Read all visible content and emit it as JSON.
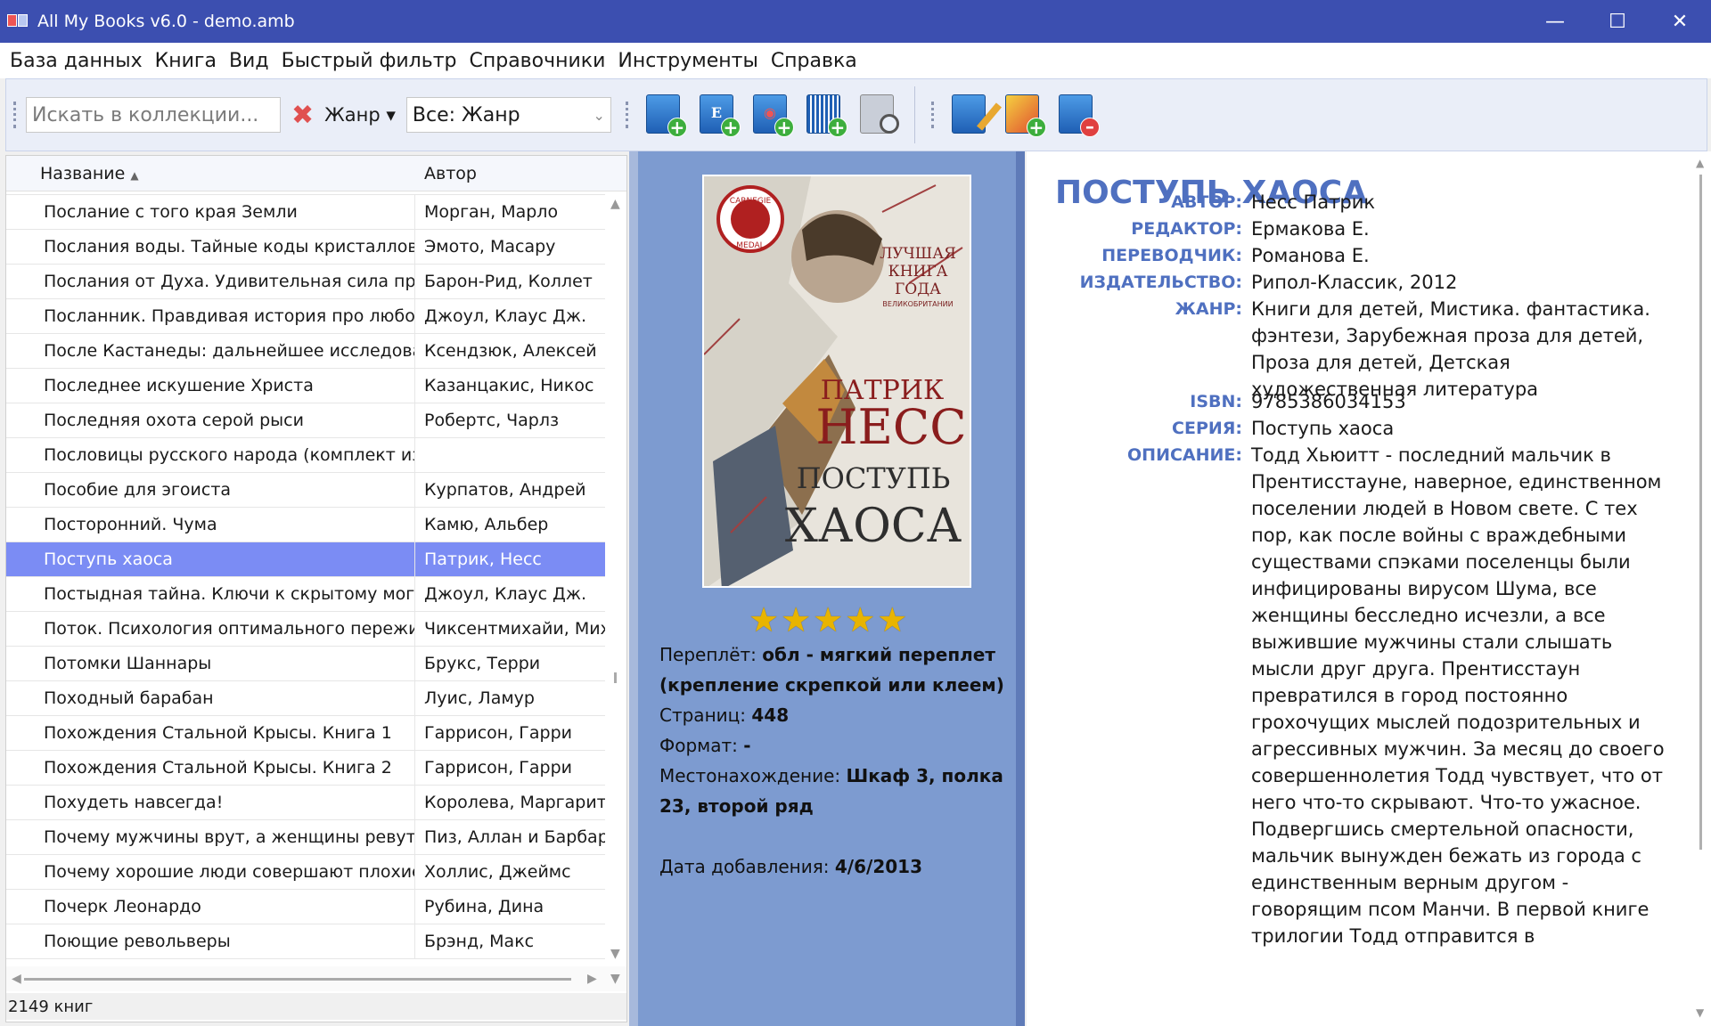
{
  "window": {
    "title": "All My Books v6.0 - demo.amb"
  },
  "menu": [
    "База данных",
    "Книга",
    "Вид",
    "Быстрый фильтр",
    "Справочники",
    "Инструменты",
    "Справка"
  ],
  "toolbar": {
    "search_placeholder": "Искать в коллекции...",
    "genre_label": "Жанр",
    "genre_value": "Все: Жанр",
    "book_letter_e": "E"
  },
  "list": {
    "col_title": "Название",
    "col_author": "Автор",
    "rows": [
      {
        "t": "Послание с того края Земли",
        "a": "Морган, Марло"
      },
      {
        "t": "Послания воды. Тайные коды кристаллов л...",
        "a": "Эмото, Масару"
      },
      {
        "t": "Послания от Духа. Удивительная сила пред...",
        "a": "Барон-Рид, Коллет"
      },
      {
        "t": "Посланник. Правдивая история про любовь",
        "a": "Джоул, Клаус Дж."
      },
      {
        "t": "После Кастанеды: дальнейшее исследование",
        "a": "Ксендзюк, Алексей"
      },
      {
        "t": "Последнее искушение Христа",
        "a": "Казанцакис, Никос"
      },
      {
        "t": "Последняя охота серой рыси",
        "a": "Робертс, Чарлз"
      },
      {
        "t": "Пословицы русского народа (комплект из ...",
        "a": ""
      },
      {
        "t": "Пособие для эгоиста",
        "a": "Курпатов, Андрей"
      },
      {
        "t": "Посторонний. Чума",
        "a": "Камю, Альбер"
      },
      {
        "t": "Поступь хаоса",
        "a": "Патрик, Несс"
      },
      {
        "t": "Постыдная тайна. Ключи к скрытому могущ...",
        "a": "Джоул, Клаус Дж."
      },
      {
        "t": "Поток. Психология оптимального пережив...",
        "a": "Чиксентмихайи, Миха"
      },
      {
        "t": "Потомки Шаннары",
        "a": "Брукс, Терри"
      },
      {
        "t": "Походный барабан",
        "a": "Луис, Ламур"
      },
      {
        "t": "Похождения Стальной Крысы. Книга 1",
        "a": "Гаррисон, Гарри"
      },
      {
        "t": "Похождения Стальной Крысы. Книга 2",
        "a": "Гаррисон, Гарри"
      },
      {
        "t": "Похудеть навсегда!",
        "a": "Королева, Маргарита"
      },
      {
        "t": "Почему мужчины врут, а женщины ревут",
        "a": "Пиз, Аллан и Барбара"
      },
      {
        "t": "Почему хорошие люди совершают плохие ...",
        "a": "Холлис, Джеймс"
      },
      {
        "t": "Почерк Леонардо",
        "a": "Рубина, Дина"
      },
      {
        "t": "Поющие револьверы",
        "a": "Брэнд, Макс"
      }
    ],
    "selected_index": 10
  },
  "status": {
    "count": "2149 книг"
  },
  "cover": {
    "medal_line1": "CARNEGIE",
    "medal_line2": "MEDAL",
    "best_line1": "ЛУЧШАЯ",
    "best_line2": "КНИГА",
    "best_line3": "ГОДА",
    "best_line4": "ВЕЛИКОБРИТАНИИ",
    "author_first": "ПАТРИК",
    "author_last": "НЕСС",
    "title_line1": "ПОСТУПЬ",
    "title_line2": "ХАОСА"
  },
  "rating": {
    "stars": 4.5,
    "display": "★★★★★"
  },
  "info": {
    "binding_label": "Переплёт:",
    "binding_value": "обл - мягкий переплет (крепление скрепкой или клеем)",
    "pages_label": "Страниц:",
    "pages_value": "448",
    "format_label": "Формат:",
    "format_value": "-",
    "location_label": "Местонахождение:",
    "location_value": "Шкаф 3, полка 23, второй ряд",
    "added_label": "Дата добавления:",
    "added_value": "4/6/2013"
  },
  "detail": {
    "title": "ПОСТУПЬ ХАОСА",
    "fields": [
      {
        "k": "АВТОР:",
        "v": "Несс Патрик"
      },
      {
        "k": "РЕДАКТОР:",
        "v": "Ермакова Е."
      },
      {
        "k": "ПЕРЕВОДЧИК:",
        "v": "Романова Е."
      },
      {
        "k": "ИЗДАТЕЛЬСТВО:",
        "v": "Рипол-Классик, 2012"
      },
      {
        "k": "ЖАНР:",
        "v": "Книги для детей, Мистика. фантастика. фэнтези, Зарубежная проза для детей, Проза для детей, Детская художественная литература"
      },
      {
        "k": "ISBN:",
        "v": "9785386034153"
      },
      {
        "k": "СЕРИЯ:",
        "v": "Поступь хаоса"
      },
      {
        "k": "ОПИСАНИЕ:",
        "v": "Тодд Хьюитт - последний мальчик в Прентисстауне, наверное, единственном поселении людей в Новом свете. С тех пор, как после войны с враждебными существами спэками поселенцы были инфицированы вирусом Шума, все женщины бесследно исчезли, а все выжившие мужчины стали слышать мысли друг друга. Прентисстаун превратился в город постоянно грохочущих мыслей подозрительных и агрессивных мужчин. За месяц до своего совершеннолетия Тодд чувствует, что от него что-то скрывают. Что-то ужасное. Подвергшись смертельной опасности, мальчик вынужден бежать из города с единственным верным другом - говорящим псом Манчи. В первой книге трилогии Тодд отправится в"
      }
    ]
  }
}
